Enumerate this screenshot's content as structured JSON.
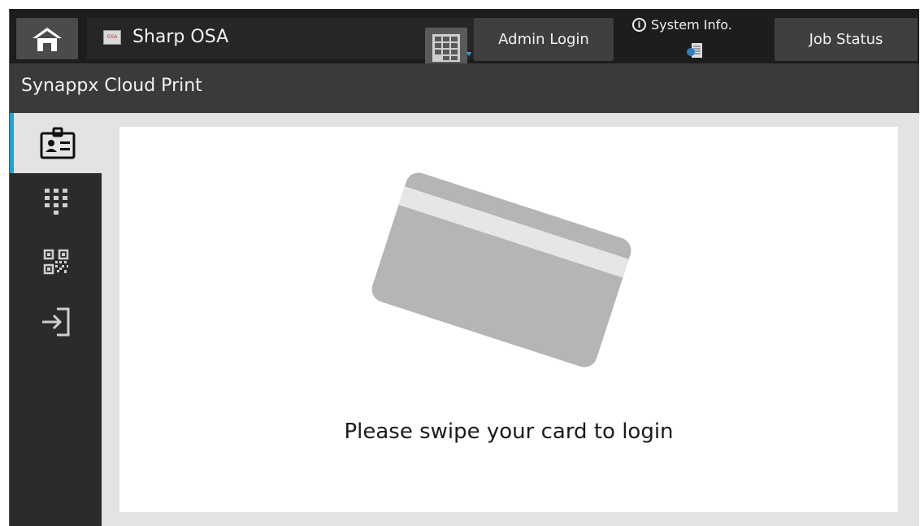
{
  "topbar": {
    "app_name": "Sharp OSA",
    "app_icon_text": "OSA",
    "admin_login": "Admin Login",
    "system_info": "System Info.",
    "job_status": "Job Status"
  },
  "title": "Synappx Cloud Print",
  "sidenav": {
    "items": [
      {
        "icon": "id-card-icon",
        "active": true
      },
      {
        "icon": "keypad-icon",
        "active": false
      },
      {
        "icon": "qr-code-icon",
        "active": false
      },
      {
        "icon": "login-arrow-icon",
        "active": false
      }
    ]
  },
  "main": {
    "prompt": "Please swipe your card to login"
  },
  "colors": {
    "accent": "#1fa3cf",
    "topbar": "#1d1d1d",
    "titlebar": "#3a3a3a",
    "card": "#b5b5b5"
  }
}
